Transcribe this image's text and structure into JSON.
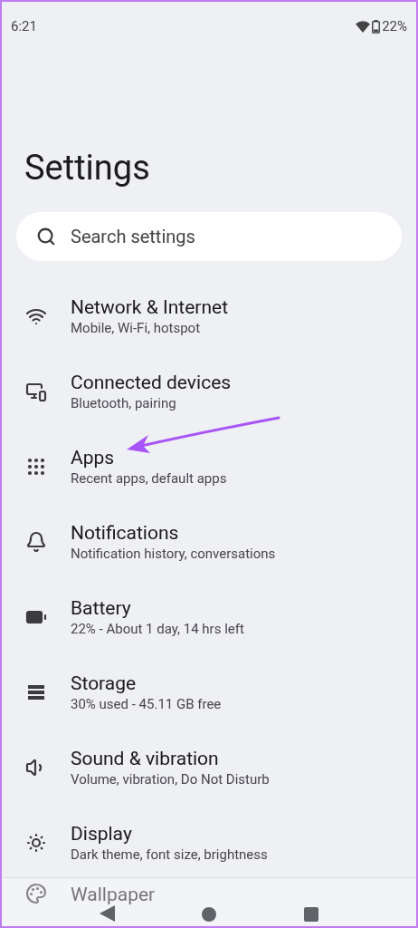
{
  "status_bar": {
    "time": "6:21",
    "battery": "22%"
  },
  "title": "Settings",
  "search": {
    "placeholder": "Search settings"
  },
  "items": [
    {
      "title": "Network & Internet",
      "subtitle": "Mobile, Wi-Fi, hotspot"
    },
    {
      "title": "Connected devices",
      "subtitle": "Bluetooth, pairing"
    },
    {
      "title": "Apps",
      "subtitle": "Recent apps, default apps"
    },
    {
      "title": "Notifications",
      "subtitle": "Notification history, conversations"
    },
    {
      "title": "Battery",
      "subtitle": "22% - About 1 day, 14 hrs left"
    },
    {
      "title": "Storage",
      "subtitle": "30% used - 45.11 GB free"
    },
    {
      "title": "Sound & vibration",
      "subtitle": "Volume, vibration, Do Not Disturb"
    },
    {
      "title": "Display",
      "subtitle": "Dark theme, font size, brightness"
    },
    {
      "title": "Wallpaper"
    }
  ]
}
